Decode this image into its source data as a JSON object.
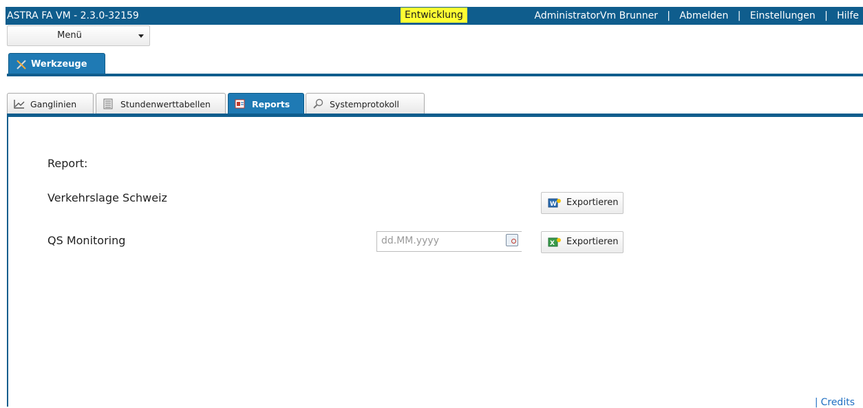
{
  "header": {
    "app_title": "ASTRA FA VM - 2.3.0-32159",
    "environment": "Entwicklung",
    "user": "AdministratorVm Brunner",
    "logout": "Abmelden",
    "settings": "Einstellungen",
    "help": "Hilfe",
    "separator": "|"
  },
  "menu": {
    "label": "Menü"
  },
  "main_tab": {
    "label": "Werkzeuge",
    "icon": "tools-icon"
  },
  "sub_tabs": [
    {
      "label": "Ganglinien",
      "icon": "line-chart-icon",
      "active": false
    },
    {
      "label": "Stundenwerttabellen",
      "icon": "table-icon",
      "active": false
    },
    {
      "label": "Reports",
      "icon": "report-icon",
      "active": true
    },
    {
      "label": "Systemprotokoll",
      "icon": "search-icon",
      "active": false
    }
  ],
  "content": {
    "report_heading": "Report:",
    "reports": [
      {
        "name": "Verkehrslage Schweiz",
        "button": "Exportieren",
        "icon": "word-export-icon"
      },
      {
        "name": "QS Monitoring",
        "date_placeholder": "dd.MM.yyyy",
        "button": "Exportieren",
        "icon": "excel-export-icon"
      }
    ]
  },
  "footer": {
    "separator": "|",
    "credits": "Credits"
  },
  "colors": {
    "header_bg": "#0f5d8d",
    "tab_active": "#1f7ab4",
    "env_badge": "#ffff33",
    "link": "#1f6fc2"
  }
}
